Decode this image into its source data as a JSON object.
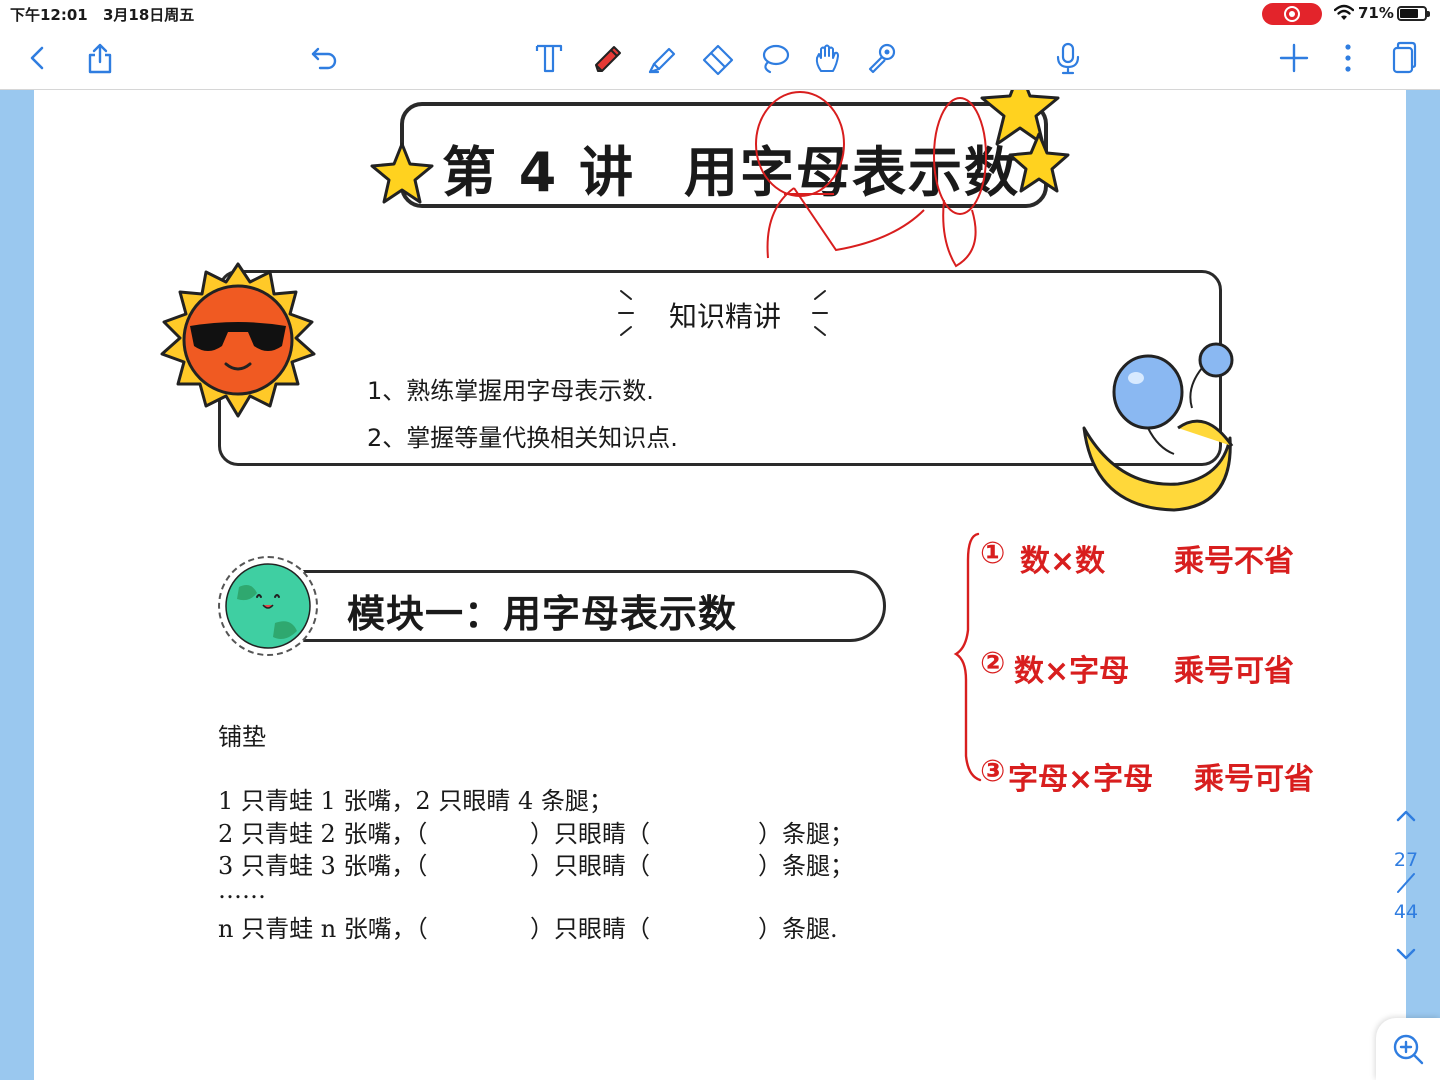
{
  "status_bar": {
    "time": "下午12:01",
    "date": "3月18日周五",
    "battery": "71%",
    "battery_level": 0.71
  },
  "toolbar": {
    "left_icons": [
      "back-icon",
      "share-icon",
      "undo-icon"
    ],
    "tool_icons": [
      "text-tool-icon",
      "pen-tool-icon",
      "highlighter-tool-icon",
      "eraser-tool-icon",
      "lasso-tool-icon",
      "hand-tool-icon",
      "laser-pointer-icon"
    ],
    "right_icons": [
      "microphone-icon",
      "add-page-icon",
      "more-icon",
      "pages-icon"
    ],
    "accent_color": "#2f7de0",
    "pen_color": "#e53935"
  },
  "document": {
    "lesson_label": "第 4 讲",
    "lesson_title": "用字母表示数",
    "knowledge_heading": "知识精讲",
    "knowledge_items": [
      "1、熟练掌握用字母表示数.",
      "2、掌握等量代换相关知识点."
    ],
    "module_title": "模块一：用字母表示数",
    "subheading": "铺垫",
    "exercise": [
      {
        "a": "1 只青蛙 1 张嘴，2 只眼睛 4 条腿；"
      },
      {
        "a": "2 只青蛙 2 张嘴，（",
        "b": "）只眼睛（",
        "c": "）条腿；"
      },
      {
        "a": "3 只青蛙 3 张嘴，（",
        "b": "）只眼睛（",
        "c": "）条腿；"
      },
      {
        "a": "……"
      },
      {
        "a": "n 只青蛙 n 张嘴，（",
        "b": "）只眼睛（",
        "c": "）条腿."
      }
    ]
  },
  "handwriting": {
    "color": "#d81e1e",
    "notes": [
      {
        "n": "①",
        "expr": "数×数",
        "rule": "乘号不省"
      },
      {
        "n": "②",
        "expr": "数×字母",
        "rule": "乘号可省"
      },
      {
        "n": "③",
        "expr": "字母×字母",
        "rule": "乘号可省"
      }
    ]
  },
  "navigation": {
    "current_page": "27",
    "total_pages": "44"
  }
}
